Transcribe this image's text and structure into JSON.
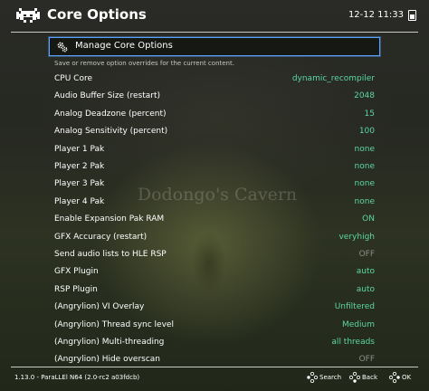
{
  "header": {
    "title": "Core Options",
    "clock": "12-12 11:33"
  },
  "menu": {
    "selected_label": "Manage Core Options",
    "selected_sublabel": "Save or remove option overrides for the current content.",
    "items": [
      {
        "label": "CPU Core",
        "value": "dynamic_recompiler",
        "state": "on"
      },
      {
        "label": "Audio Buffer Size (restart)",
        "value": "2048",
        "state": "on"
      },
      {
        "label": "Analog Deadzone (percent)",
        "value": "15",
        "state": "on"
      },
      {
        "label": "Analog Sensitivity (percent)",
        "value": "100",
        "state": "on"
      },
      {
        "label": "Player 1 Pak",
        "value": "none",
        "state": "on"
      },
      {
        "label": "Player 2 Pak",
        "value": "none",
        "state": "on"
      },
      {
        "label": "Player 3 Pak",
        "value": "none",
        "state": "on"
      },
      {
        "label": "Player 4 Pak",
        "value": "none",
        "state": "on"
      },
      {
        "label": "Enable Expansion Pak RAM",
        "value": "ON",
        "state": "on"
      },
      {
        "label": "GFX Accuracy (restart)",
        "value": "veryhigh",
        "state": "on"
      },
      {
        "label": "Send audio lists to HLE RSP",
        "value": "OFF",
        "state": "off"
      },
      {
        "label": "GFX Plugin",
        "value": "auto",
        "state": "on"
      },
      {
        "label": "RSP Plugin",
        "value": "auto",
        "state": "on"
      },
      {
        "label": "(Angrylion) VI Overlay",
        "value": "Unfiltered",
        "state": "on"
      },
      {
        "label": "(Angrylion) Thread sync level",
        "value": "Medium",
        "state": "on"
      },
      {
        "label": "(Angrylion) Multi-threading",
        "value": "all threads",
        "state": "on"
      },
      {
        "label": "(Angrylion) Hide overscan",
        "value": "OFF",
        "state": "off"
      }
    ]
  },
  "background": {
    "text": "Dodongo's Cavern"
  },
  "footer": {
    "version": "1.13.0 - ParaLLEl N64 (2.0-rc2 a03fdcb)",
    "search_label": "Search",
    "back_label": "Back",
    "ok_label": "OK"
  },
  "colors": {
    "accent": "#5aa2ff",
    "value_on": "#5bd7a0",
    "value_off": "#8e8e88"
  },
  "icons": {
    "logo": "retroarch-invader-icon",
    "selected": "gears-icon",
    "battery": "battery-icon",
    "footer_buttons": "gamepad-face-buttons-icon"
  }
}
